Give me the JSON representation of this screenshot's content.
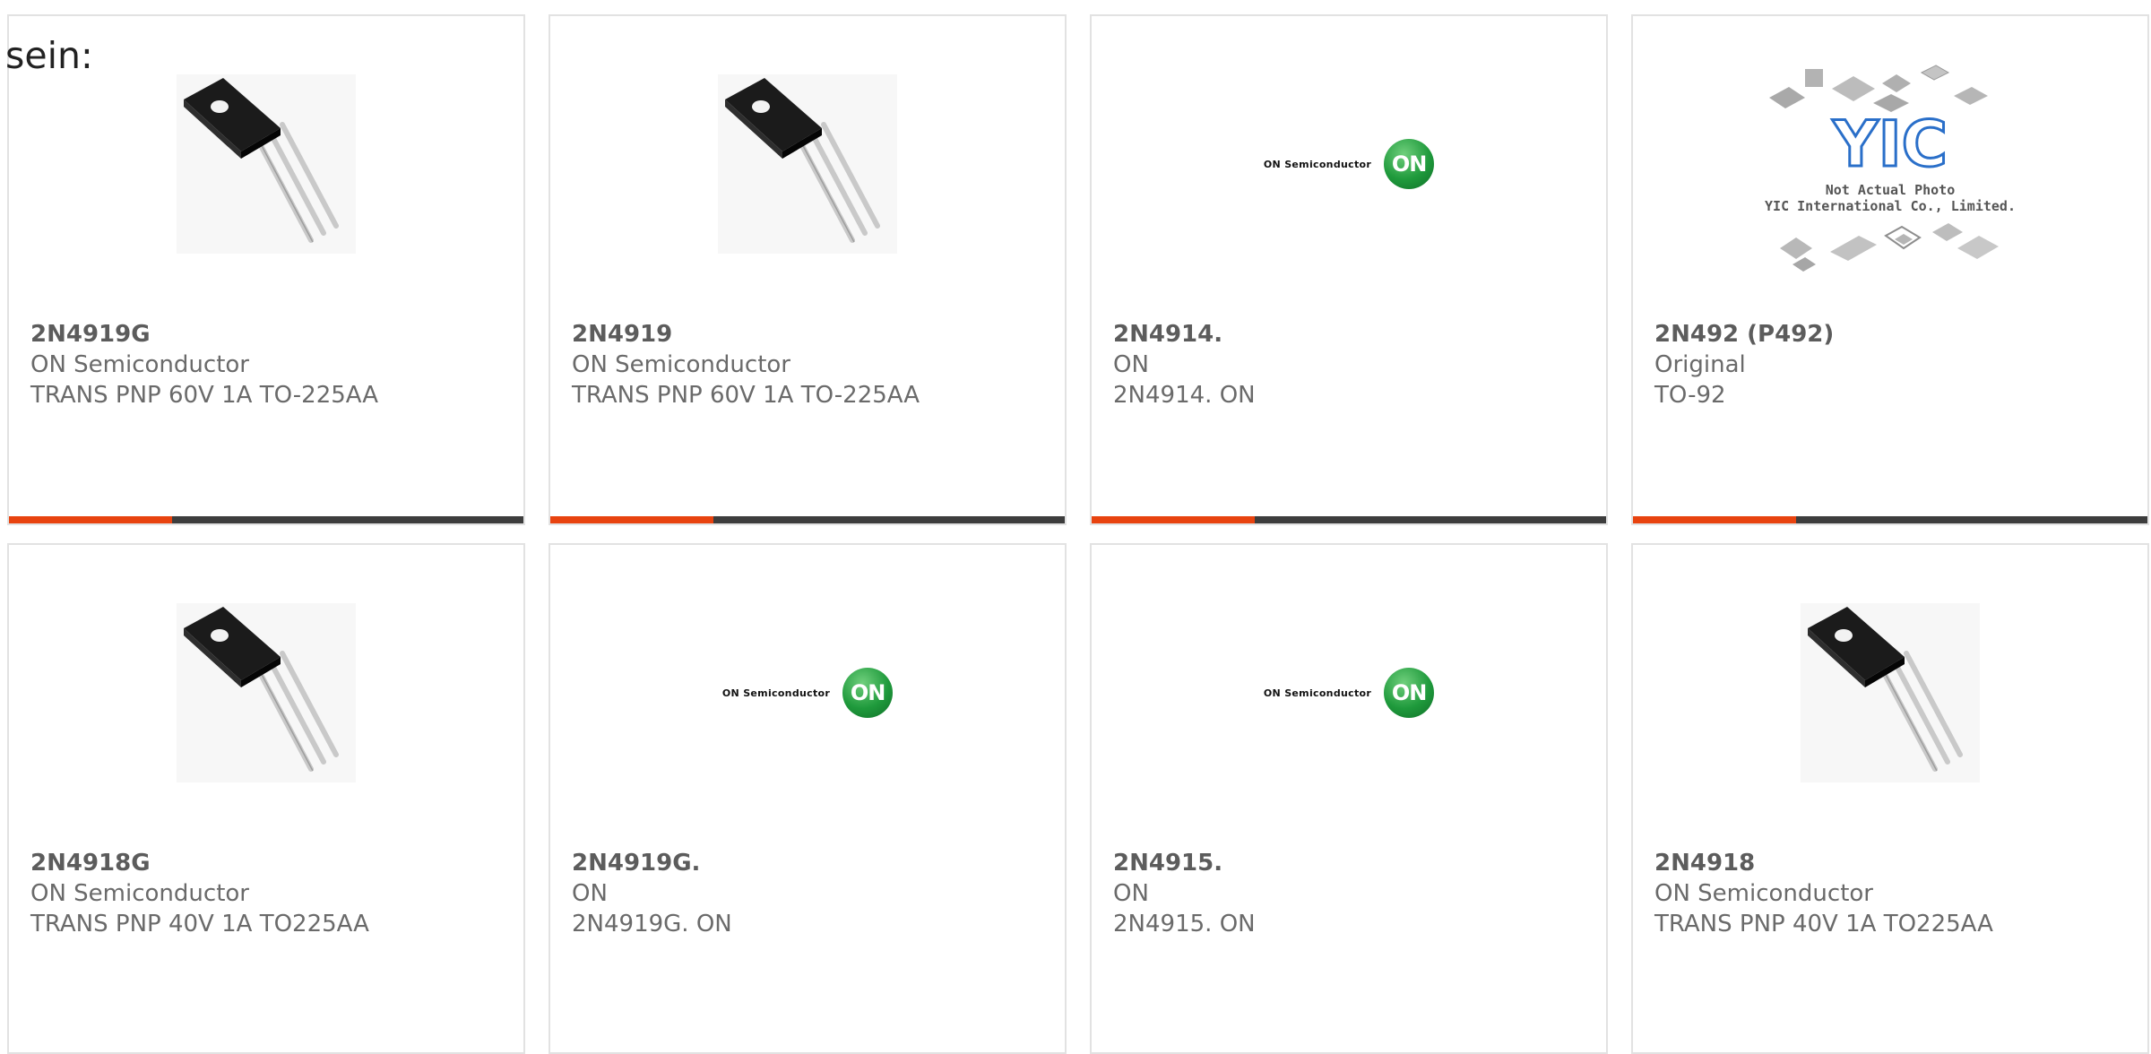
{
  "heading": "sein:",
  "image_labels": {
    "on_logo_text": "ON Semiconductor",
    "on_logo_mark": "ON",
    "yic_mark": "YIC",
    "yic_caption_line1": "Not Actual Photo",
    "yic_caption_line2": "YIC International Co., Limited."
  },
  "colors": {
    "accent": "#e8430f",
    "bar": "#3d3d3d",
    "border": "#e2e2e2",
    "text": "#6a6a6a",
    "on_green": "#1f9a3c"
  },
  "cards": [
    {
      "part": "2N4919G",
      "maker": "ON Semiconductor",
      "desc": "TRANS PNP 60V 1A TO-225AA",
      "image": "transistor-photo",
      "bar": true
    },
    {
      "part": "2N4919",
      "maker": "ON Semiconductor",
      "desc": "TRANS PNP 60V 1A TO-225AA",
      "image": "transistor-photo",
      "bar": true
    },
    {
      "part": "2N4914.",
      "maker": "ON",
      "desc": "2N4914. ON",
      "image": "on-semiconductor-logo",
      "bar": true
    },
    {
      "part": "2N492 (P492)",
      "maker": "Original",
      "desc": "TO-92",
      "image": "yic-placeholder",
      "bar": true
    },
    {
      "part": "2N4918G",
      "maker": "ON Semiconductor",
      "desc": "TRANS PNP 40V 1A TO225AA",
      "image": "transistor-photo",
      "bar": false
    },
    {
      "part": "2N4919G.",
      "maker": "ON",
      "desc": "2N4919G. ON",
      "image": "on-semiconductor-logo",
      "bar": false
    },
    {
      "part": "2N4915.",
      "maker": "ON",
      "desc": "2N4915. ON",
      "image": "on-semiconductor-logo",
      "bar": false
    },
    {
      "part": "2N4918",
      "maker": "ON Semiconductor",
      "desc": "TRANS PNP 40V 1A TO225AA",
      "image": "transistor-photo",
      "bar": false
    }
  ]
}
